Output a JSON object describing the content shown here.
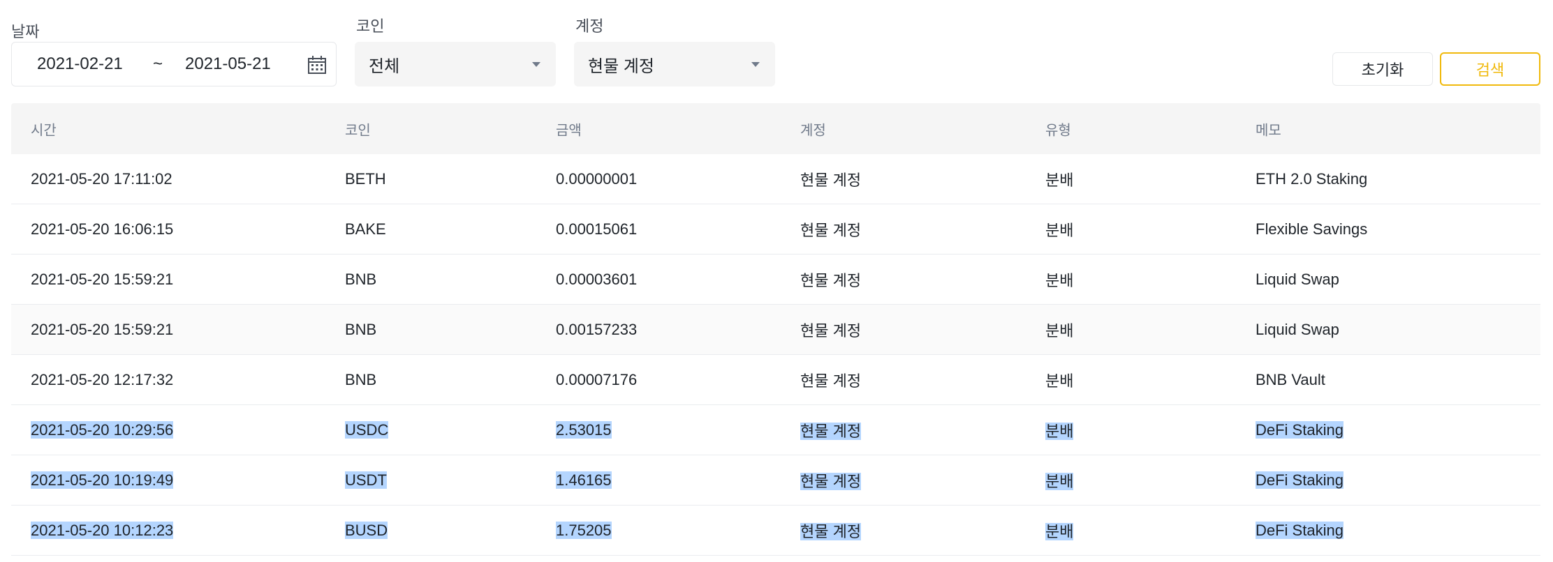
{
  "filters": {
    "date_label": "날짜",
    "date_from": "2021-02-21",
    "date_sep": "~",
    "date_to": "2021-05-21",
    "coin_label": "코인",
    "coin_value": "전체",
    "account_label": "계정",
    "account_value": "현물 계정"
  },
  "buttons": {
    "reset": "초기화",
    "search": "검색"
  },
  "colors": {
    "accent": "#f0b90b",
    "selection": "#b4d5fe",
    "header_bg": "#f5f5f5"
  },
  "table": {
    "columns": [
      "시간",
      "코인",
      "금액",
      "계정",
      "유형",
      "메모"
    ],
    "rows": [
      [
        "2021-05-20 17:11:02",
        "BETH",
        "0.00000001",
        "현물 계정",
        "분배",
        "ETH 2.0 Staking"
      ],
      [
        "2021-05-20 16:06:15",
        "BAKE",
        "0.00015061",
        "현물 계정",
        "분배",
        "Flexible Savings"
      ],
      [
        "2021-05-20 15:59:21",
        "BNB",
        "0.00003601",
        "현물 계정",
        "분배",
        "Liquid Swap"
      ],
      [
        "2021-05-20 15:59:21",
        "BNB",
        "0.00157233",
        "현물 계정",
        "분배",
        "Liquid Swap"
      ],
      [
        "2021-05-20 12:17:32",
        "BNB",
        "0.00007176",
        "현물 계정",
        "분배",
        "BNB Vault"
      ],
      [
        "2021-05-20 10:29:56",
        "USDC",
        "2.53015",
        "현물 계정",
        "분배",
        "DeFi Staking"
      ],
      [
        "2021-05-20 10:19:49",
        "USDT",
        "1.46165",
        "현물 계정",
        "분배",
        "DeFi Staking"
      ],
      [
        "2021-05-20 10:12:23",
        "BUSD",
        "1.75205",
        "현물 계정",
        "분배",
        "DeFi Staking"
      ]
    ]
  }
}
